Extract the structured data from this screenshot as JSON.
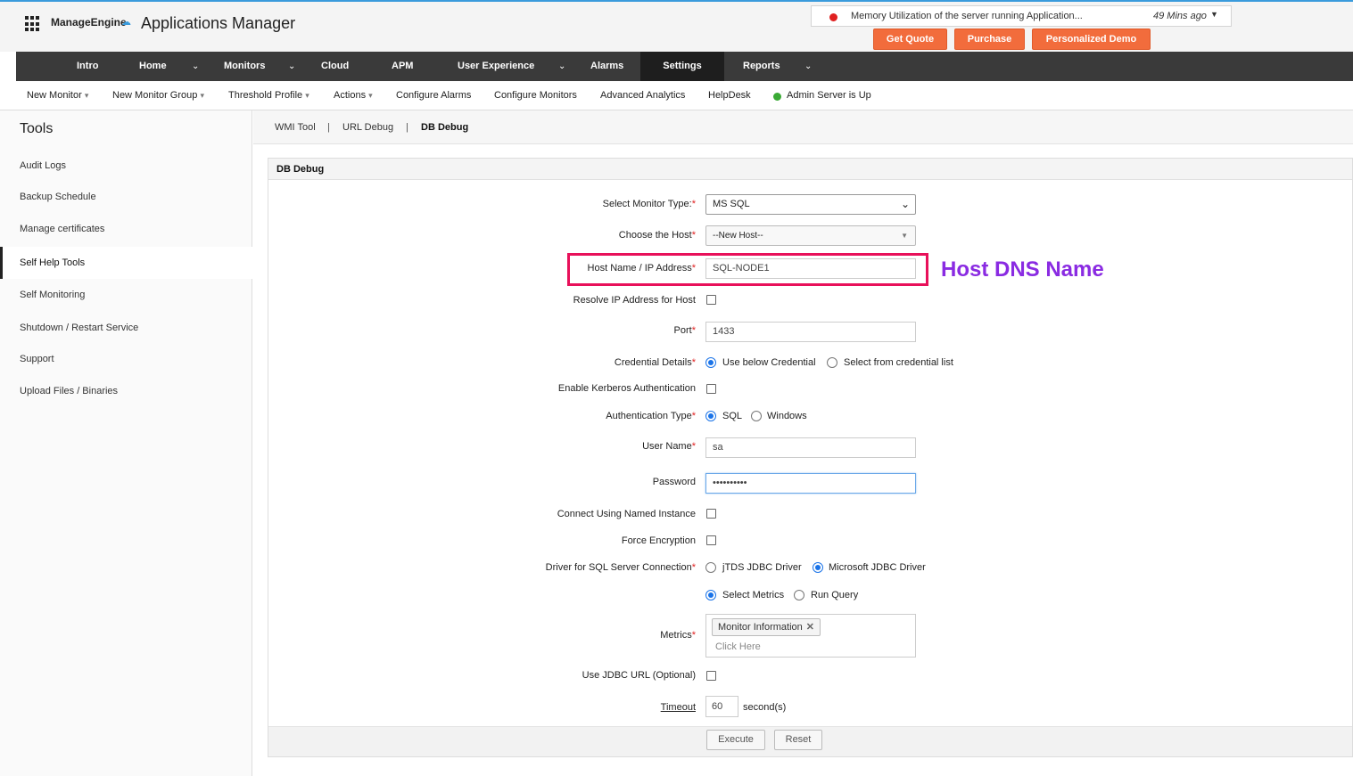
{
  "header": {
    "brand": "ManageEngine",
    "product": "Applications Manager",
    "notification": {
      "text": "Memory Utilization of the server running Application...",
      "time": "49 Mins ago"
    },
    "buttons": {
      "get_quote": "Get Quote",
      "purchase": "Purchase",
      "demo": "Personalized Demo"
    }
  },
  "mainnav": {
    "items": [
      "Intro",
      "Home",
      "Monitors",
      "Cloud",
      "APM",
      "User Experience",
      "Alarms",
      "Settings",
      "Reports"
    ],
    "active": "Settings"
  },
  "subnav": {
    "new_monitor": "New Monitor",
    "new_monitor_group": "New Monitor Group",
    "threshold_profile": "Threshold Profile",
    "actions": "Actions",
    "configure_alarms": "Configure Alarms",
    "configure_monitors": "Configure Monitors",
    "advanced_analytics": "Advanced Analytics",
    "helpdesk": "HelpDesk",
    "server_status": "Admin Server is Up",
    "status_color": "#3aaa35"
  },
  "sidebar": {
    "title": "Tools",
    "items": [
      "Audit Logs",
      "Backup Schedule",
      "Manage certificates",
      "Self Help Tools",
      "Self Monitoring",
      "Shutdown / Restart Service",
      "Support",
      "Upload Files / Binaries"
    ],
    "active": "Self Help Tools"
  },
  "tooltabs": {
    "wmi": "WMI Tool",
    "url": "URL Debug",
    "db": "DB Debug",
    "sep": "|"
  },
  "panel": {
    "title": "DB Debug",
    "monitor_type": {
      "label": "Select Monitor Type:",
      "value": "MS SQL"
    },
    "host": {
      "label": "Choose the Host",
      "value": "--New Host--"
    },
    "hostname": {
      "label": "Host Name / IP Address",
      "value": "SQL-NODE1"
    },
    "resolve_ip": {
      "label": "Resolve IP Address for Host"
    },
    "port": {
      "label": "Port",
      "value": "1433"
    },
    "credential": {
      "label": "Credential Details",
      "opt1": "Use below Credential",
      "opt2": "Select from credential list"
    },
    "kerberos": {
      "label": "Enable Kerberos Authentication"
    },
    "auth_type": {
      "label": "Authentication Type",
      "opt1": "SQL",
      "opt2": "Windows"
    },
    "username": {
      "label": "User Name",
      "value": "sa"
    },
    "password": {
      "label": "Password",
      "value": "••••••••••"
    },
    "named_instance": {
      "label": "Connect Using Named Instance"
    },
    "force_encryption": {
      "label": "Force Encryption"
    },
    "driver": {
      "label": "Driver for SQL Server Connection",
      "opt1": "jTDS JDBC Driver",
      "opt2": "Microsoft JDBC Driver"
    },
    "mode": {
      "opt1": "Select Metrics",
      "opt2": "Run Query"
    },
    "metrics": {
      "label": "Metrics",
      "chip": "Monitor Information",
      "placeholder": "Click Here"
    },
    "jdbc_url": {
      "label": "Use JDBC URL (Optional)"
    },
    "timeout": {
      "label": "Timeout",
      "value": "60",
      "unit": "second(s)"
    },
    "execute": "Execute",
    "reset": "Reset"
  },
  "annotation": {
    "text": "Host DNS Name",
    "color": "#8a2be2",
    "box_color": "#e8105a"
  },
  "colors": {
    "accent_button": "#f26c3c",
    "nav_bg": "#3a3a3a",
    "radio_on": "#1a73e8"
  }
}
